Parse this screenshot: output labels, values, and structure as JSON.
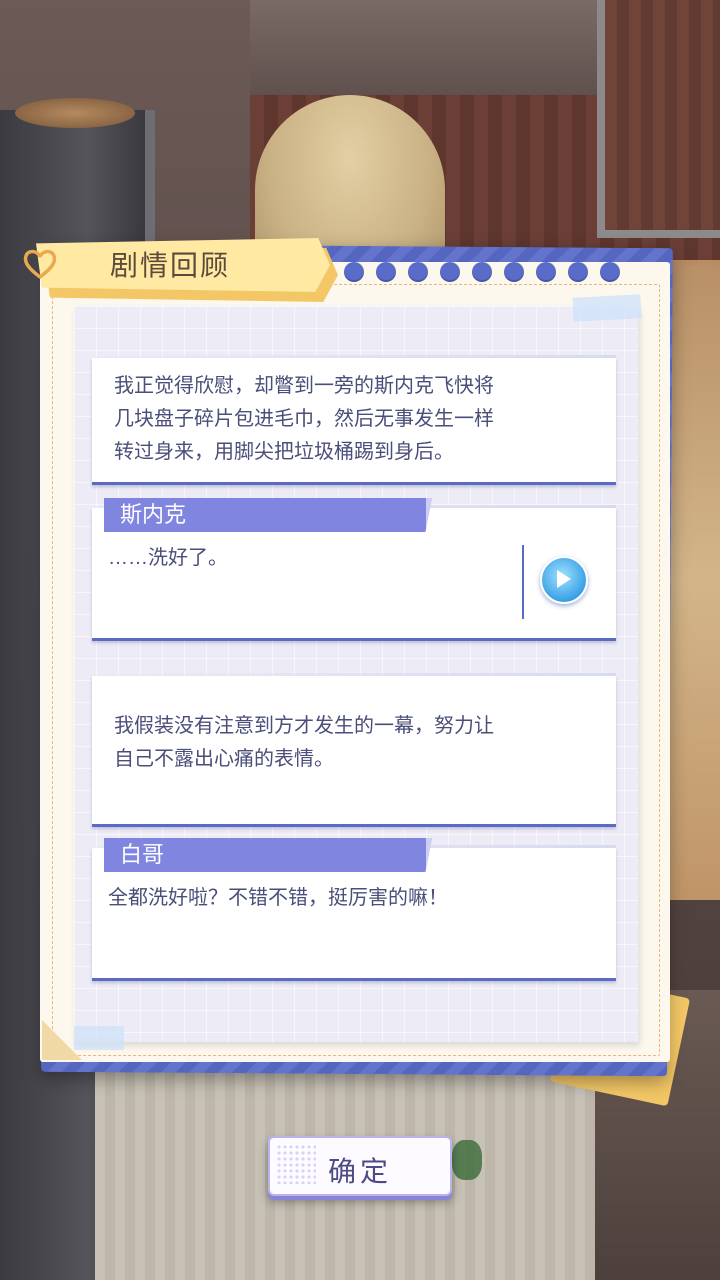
{
  "panel": {
    "title": "剧情回顾",
    "dot_count": 10
  },
  "dialogues": [
    {
      "speaker": "",
      "text": "我正觉得欣慰，却瞥到一旁的斯内克飞快将\n几块盘子碎片包进毛巾，然后无事发生一样\n转过身来，用脚尖把垃圾桶踢到身后。"
    },
    {
      "speaker": "斯内克",
      "text": "……洗好了。",
      "has_voice": true
    },
    {
      "speaker": "",
      "text": "我假装没有注意到方才发生的一幕，努力让\n自己不露出心痛的表情。"
    },
    {
      "speaker": "白哥",
      "text": "全都洗好啦？不错不错，挺厉害的嘛！"
    }
  ],
  "confirm_label": "确定",
  "colors": {
    "accent_blue": "#5b6bc4",
    "name_tag": "#8086df",
    "banner_yellow": "#ffe9a3",
    "text": "#4a4f7a"
  },
  "icons": {
    "play": "play-icon",
    "heart": "heart-clip-icon"
  }
}
